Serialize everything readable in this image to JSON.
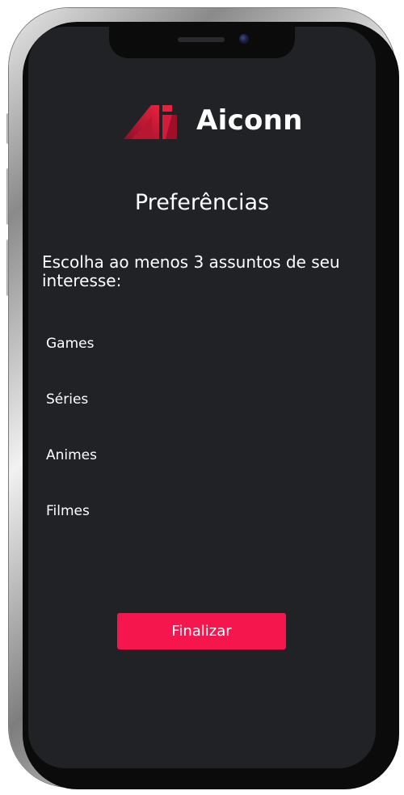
{
  "app": {
    "brand_name": "Aiconn",
    "logo_icon": "aiconn-logo-icon",
    "accent_color": "#f4164c",
    "background_color": "#202226"
  },
  "page": {
    "title": "Preferências",
    "instruction": "Escolha ao menos 3 assuntos de seu interesse:"
  },
  "options": [
    {
      "label": "Games"
    },
    {
      "label": "Séries"
    },
    {
      "label": "Animes"
    },
    {
      "label": "Filmes"
    }
  ],
  "actions": {
    "finish_label": "Finalizar"
  }
}
